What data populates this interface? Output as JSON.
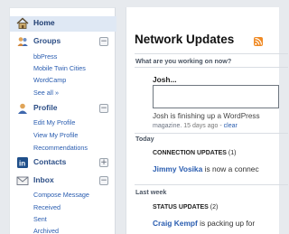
{
  "sidebar": {
    "home": {
      "label": "Home"
    },
    "groups": {
      "label": "Groups",
      "toggle": "−",
      "items": [
        "bbPress",
        "Mobile Twin Cities",
        "WordCamp",
        "See all »"
      ]
    },
    "profile": {
      "label": "Profile",
      "toggle": "−",
      "items": [
        "Edit My Profile",
        "View My Profile",
        "Recommendations"
      ]
    },
    "contacts": {
      "label": "Contacts",
      "toggle": "+"
    },
    "inbox": {
      "label": "Inbox",
      "toggle": "−",
      "items": [
        "Compose Message",
        "Received",
        "Sent",
        "Archived"
      ]
    }
  },
  "main": {
    "title": "Network Updates",
    "prompt": "What are you working on now?",
    "user_name": "Josh...",
    "status_text": "Josh is finishing up a WordPress",
    "status_continued": "magazine.",
    "status_ago": "15 days ago",
    "status_sep": "-",
    "status_clear": "clear",
    "today_label": "Today",
    "connection_updates": {
      "label": "CONNECTION UPDATES",
      "count": "(1)"
    },
    "connection_entry": {
      "name": "Jimmy Vosika",
      "text": "is now a connec"
    },
    "lastweek_label": "Last week",
    "status_updates": {
      "label": "STATUS UPDATES",
      "count": "(2)"
    },
    "status_entry": {
      "name": "Craig Kempf",
      "text": "is packing up for"
    }
  },
  "icons": {
    "home": "house-icon",
    "groups": "people-icon",
    "profile": "person-icon",
    "contacts": "linkedin-in-icon",
    "inbox": "envelope-icon",
    "rss": "rss-feed-icon"
  }
}
